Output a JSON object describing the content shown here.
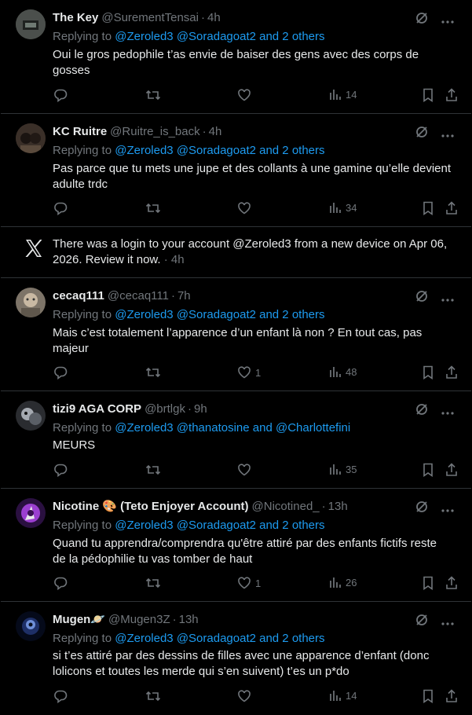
{
  "tweets": [
    {
      "name": "The Key",
      "handle": "@SurementTensai",
      "time": "4h",
      "reply_prefix": "Replying to",
      "reply_mentions": "@Zeroled3 @Soradagoat2 and 2 others",
      "text_lines": [
        "Oui le gros pedophile t’as envie de baiser des gens avec des corps de",
        "gosses"
      ],
      "likes": "",
      "views": "14"
    },
    {
      "name": "KC Ruitre",
      "handle": "@Ruitre_is_back",
      "time": "4h",
      "reply_prefix": "Replying to",
      "reply_mentions": "@Zeroled3 @Soradagoat2 and 2 others",
      "text_lines": [
        "Pas parce que tu mets une jupe et des collants à une gamine qu’elle devient",
        "adulte trdc"
      ],
      "likes": "",
      "views": "34"
    },
    {
      "name": "cecaq111",
      "handle": "@cecaq111",
      "time": "7h",
      "reply_prefix": "Replying to",
      "reply_mentions": "@Zeroled3 @Soradagoat2 and 2 others",
      "text_lines": [
        "Mais c’est totalement l’apparence d’un enfant là non ? En tout cas, pas",
        "majeur"
      ],
      "likes": "1",
      "views": "48"
    },
    {
      "name": "tizi9 AGA CORP",
      "handle": "@brtlgk",
      "time": "9h",
      "reply_prefix": "Replying to",
      "reply_mentions": "@Zeroled3 @thanatosine and @Charlottefini",
      "text_lines": [
        "MEURS"
      ],
      "likes": "",
      "views": "35"
    },
    {
      "name": "Nicotine 🎨 (Teto Enjoyer Account)",
      "handle": "@Nicotined_",
      "time": "13h",
      "reply_prefix": "Replying to",
      "reply_mentions": "@Zeroled3 @Soradagoat2 and 2 others",
      "text_lines": [
        "Quand tu apprendra/comprendra qu'être attiré par des enfants fictifs reste",
        "de la pédophilie tu vas tomber de haut"
      ],
      "likes": "1",
      "views": "26"
    },
    {
      "name": "Mugen🪐",
      "handle": "@Mugen3Z",
      "time": "13h",
      "reply_prefix": "Replying to",
      "reply_mentions": "@Zeroled3 @Soradagoat2 and 2 others",
      "text_lines": [
        "si t’es attiré par des dessins de filles avec une apparence d’enfant (donc",
        "lolicons et toutes les merde qui s’en suivent) t’es un p*do"
      ],
      "likes": "",
      "views": "14"
    }
  ],
  "notification": {
    "line1": "There was a login to your account @Zeroled3 from a new device on Apr 06,",
    "line2": "2026. Review it now.",
    "time": "4h"
  },
  "icons": [
    "reply-icon",
    "retweet-icon",
    "like-icon",
    "views-icon",
    "bookmark-icon",
    "share-icon",
    "grok-icon",
    "more-icon",
    "x-logo-icon"
  ],
  "colors": {
    "background": "#000000",
    "text": "#e7e9ea",
    "muted": "#71767b",
    "accent": "#1d9bf0",
    "border": "#2f3336"
  }
}
